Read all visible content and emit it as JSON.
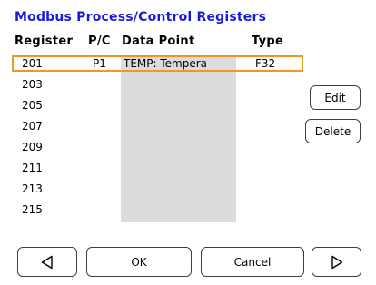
{
  "dialog": {
    "title": "Modbus Process/Control Registers"
  },
  "table": {
    "headers": {
      "register": "Register",
      "pc": "P/C",
      "data_point": "Data Point",
      "type": "Type"
    },
    "rows": [
      {
        "register": "201",
        "pc": "P1",
        "data_point": "TEMP: Tempera",
        "type": "F32",
        "selected": true
      },
      {
        "register": "203",
        "pc": "",
        "data_point": "",
        "type": ""
      },
      {
        "register": "205",
        "pc": "",
        "data_point": "",
        "type": ""
      },
      {
        "register": "207",
        "pc": "",
        "data_point": "",
        "type": ""
      },
      {
        "register": "209",
        "pc": "",
        "data_point": "",
        "type": ""
      },
      {
        "register": "211",
        "pc": "",
        "data_point": "",
        "type": ""
      },
      {
        "register": "213",
        "pc": "",
        "data_point": "",
        "type": ""
      },
      {
        "register": "215",
        "pc": "",
        "data_point": "",
        "type": ""
      }
    ]
  },
  "side_buttons": {
    "edit_label": "Edit",
    "delete_label": "Delete"
  },
  "footer": {
    "prev_icon": "triangle-left-icon",
    "ok_label": "OK",
    "cancel_label": "Cancel",
    "next_icon": "triangle-right-icon"
  },
  "colors": {
    "title": "#1a1adc",
    "selection_border": "#f09a1a",
    "column_shade": "#dcdcdc"
  }
}
